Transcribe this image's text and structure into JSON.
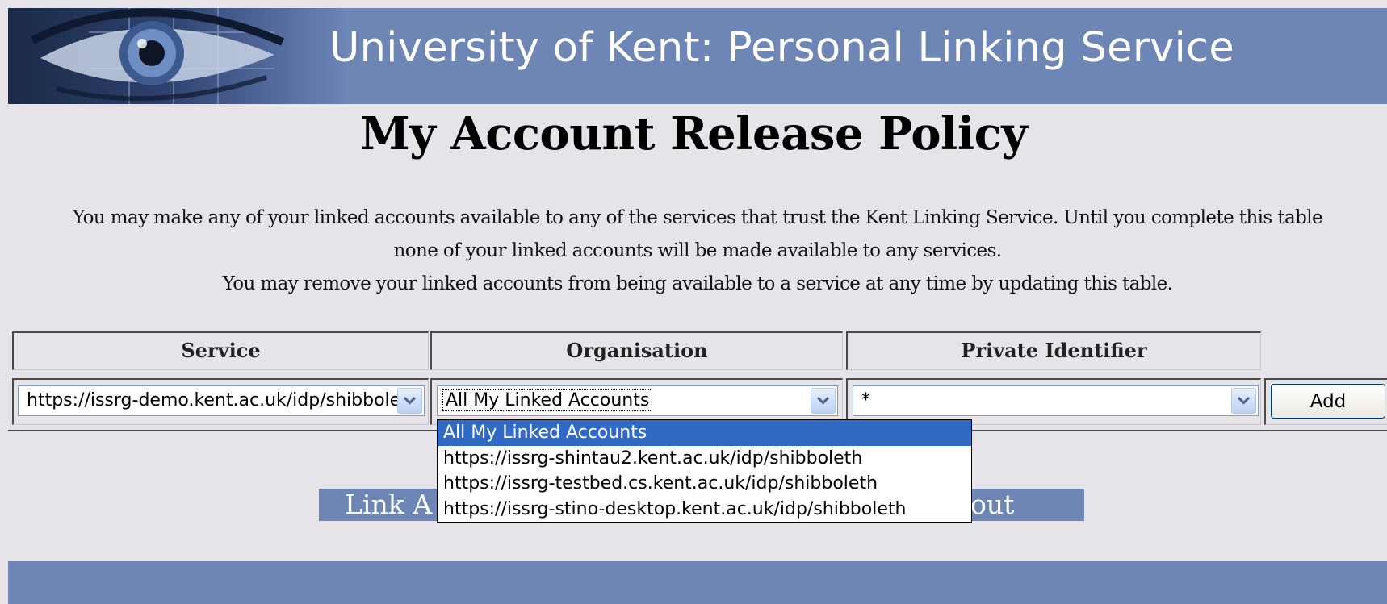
{
  "header": {
    "site_title": "University of Kent: Personal Linking Service"
  },
  "page": {
    "title": "My Account Release Policy"
  },
  "intro": {
    "line1": "You may make any of your linked accounts available to any of the services that trust the Kent Linking Service. Until you complete this table",
    "line2": "none of your linked accounts will be made available to any services.",
    "line3": "You may remove your linked accounts from being available to a service at any time by updating this table."
  },
  "table": {
    "headers": {
      "service": "Service",
      "organisation": "Organisation",
      "private_identifier": "Private Identifier"
    },
    "row": {
      "service_value": "https://issrg-demo.kent.ac.uk/idp/shibboleth",
      "organisation_value": "All My Linked Accounts",
      "identifier_value": "*",
      "add_label": "Add"
    }
  },
  "dropdown": {
    "options": [
      "All My Linked Accounts",
      "https://issrg-shintau2.kent.ac.uk/idp/shibboleth",
      "https://issrg-testbed.cs.kent.ac.uk/idp/shibboleth",
      "https://issrg-stino-desktop.kent.ac.uk/idp/shibboleth"
    ],
    "selected_index": 0
  },
  "nav": {
    "link_label": "Link A",
    "logout_label": "out"
  },
  "colors": {
    "banner": "#6d86b6",
    "page_bg": "#e7e4e9",
    "selection": "#316ac5"
  },
  "icons": {
    "header_graphic": "eye-graphic",
    "select_arrow": "chevron-down-icon"
  }
}
